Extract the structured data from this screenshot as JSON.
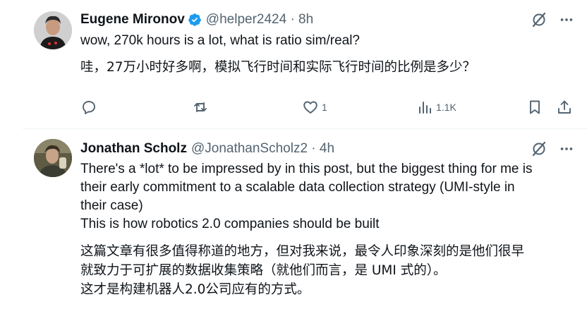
{
  "tweets": [
    {
      "display_name": "Eugene Mironov",
      "verified": true,
      "handle": "@helper2424 · 8h",
      "text_en": "wow, 270k hours is a lot, what is ratio sim/real?",
      "text_zh": "哇，27万小时好多啊，模拟飞行时间和实际飞行时间的比例是多少？",
      "actions": {
        "reply_icon": "reply-icon",
        "retweet_icon": "retweet-icon",
        "like_icon": "heart-icon",
        "like_count": "1",
        "views_icon": "views-icon",
        "views_count": "1.1K",
        "bookmark_icon": "bookmark-icon",
        "share_icon": "share-icon"
      }
    },
    {
      "display_name": "Jonathan Scholz",
      "handle": "@JonathanScholz2 · 4h",
      "text_en_lines": [
        "There's a *lot* to be impressed by in this post, but the biggest thing for me is",
        "their early commitment to a scalable data collection strategy (UMI-style in",
        "their case)",
        "This is how robotics 2.0 companies should be built"
      ],
      "text_zh_lines": [
        "这篇文章有很多值得称道的地方，但对我来说，最令人印象深刻的是他们很早",
        "就致力于可扩展的数据收集策略（就他们而言，是 UMI 式的）。",
        "这才是构建机器人2.0公司应有的方式。"
      ]
    }
  ],
  "colors": {
    "text": "#0f1419",
    "secondary": "#536471",
    "verified_blue": "#1d9bf0",
    "divider": "#eff3f4"
  }
}
